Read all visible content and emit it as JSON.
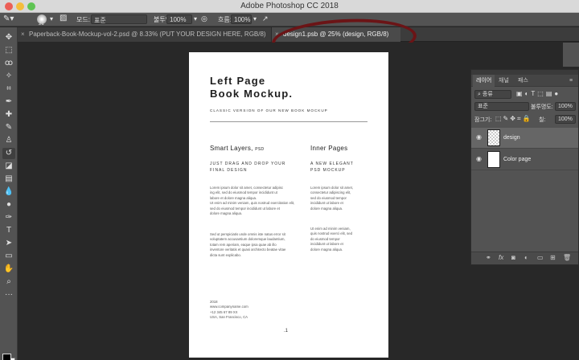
{
  "window": {
    "title": "Adobe Photoshop CC 2018"
  },
  "options_bar": {
    "brush_size": "21",
    "mode_label": "모드:",
    "mode_value": "표준",
    "opacity_label": "불투명도:",
    "opacity_value": "100%",
    "flow_label": "흐름:",
    "flow_value": "100%"
  },
  "tabs": [
    {
      "label": "Paperback-Book-Mockup-vol-2.psd @ 8.33% (PUT YOUR DESIGN HERE, RGB/8)",
      "close": "×"
    },
    {
      "label": "design1.psb @ 25% (design, RGB/8)",
      "close": "×"
    }
  ],
  "document": {
    "title_line1": "Left Page",
    "title_line2": "Book Mockup.",
    "subtitle": "CLASSIC VERSION OF OUR NEW BOOK MOCKUP",
    "left_heading": "Smart Layers,",
    "left_heading_small": "PSD",
    "left_caps_1": "JUST DRAG AND DROP YOUR",
    "left_caps_2": "FINAL DESIGN",
    "left_body_1": [
      "Lorem ipsum dolor sit amet, consectetur adipisc",
      "ing elit, sed do eiusmod tempor incididunt ut",
      "labore et dolore magna aliqua.",
      "Ut enim ad minim veniam, quis nostrud exercitation elit,",
      "sed do eiusmod tempor incididunt ut labore et",
      "dolore magna aliqua."
    ],
    "left_body_2": [
      "Sed ut perspiciatis unde omnis iste natus error sit",
      "voluptatem accusantium doloremque laudantium,",
      "totam rem aperiam, eaque ipsa quae ab illo",
      "inventore veritatis et quasi architecto beatae vitae",
      "dicta sunt explicabo."
    ],
    "right_heading": "Inner Pages",
    "right_caps_1": "A NEW ELEGANT",
    "right_caps_2": "PSD MOCKUP",
    "right_body_1": [
      "Lorem ipsum dolor sit amet,",
      "consectetur adipiscing elit,",
      "sed do eiusmod tempor",
      "incididunt ut labore et",
      "dolore magna aliqua."
    ],
    "right_body_2": [
      "Ut enim ad minim veniam,",
      "quis nostrud exerci elit, sed",
      "do eiusmod tempor",
      "incididunt ut labore et",
      "dolore magna aliqua."
    ],
    "footer": [
      "2018",
      "www.companyname.com",
      "+12 345 67 89 XX",
      "USA, San Francisco, CA"
    ],
    "page_number": ".1"
  },
  "layers_panel": {
    "tabs": [
      "레이어",
      "채널",
      "패스"
    ],
    "filter_label": "종류",
    "blend_mode": "표준",
    "opacity_label": "불투명도:",
    "opacity_value": "100%",
    "lock_label": "잠그기:",
    "fill_label": "칠:",
    "fill_value": "100%",
    "layers": [
      {
        "name": "design",
        "selected": true
      },
      {
        "name": "Color page",
        "selected": false
      }
    ]
  }
}
